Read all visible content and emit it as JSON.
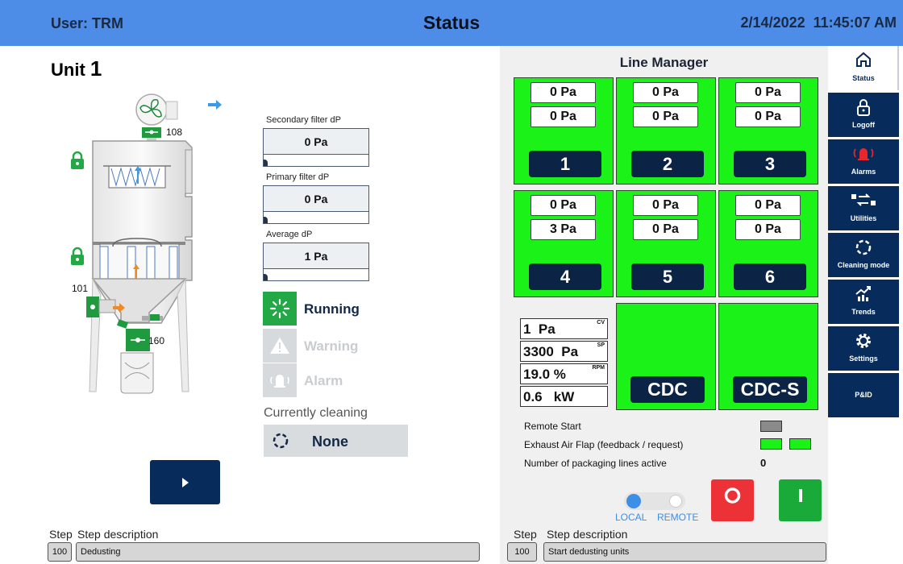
{
  "header": {
    "user": "User: TRM",
    "title": "Status",
    "datetime": "2/14/2022  11:45:07 AM"
  },
  "unit": {
    "title": "Unit",
    "number": "1",
    "labels": {
      "fan_id": "108",
      "left_valve_id": "101",
      "bottom_valve_id": "160"
    }
  },
  "filters": [
    {
      "label": "Secondary filter dP",
      "value": "0 Pa"
    },
    {
      "label": "Primary filter dP",
      "value": "0 Pa"
    },
    {
      "label": "Average dP",
      "value": "1 Pa"
    }
  ],
  "states": {
    "running": "Running",
    "warning": "Warning",
    "alarm": "Alarm"
  },
  "cleaning": {
    "label": "Currently cleaning",
    "value": "None"
  },
  "steps_left": {
    "step_header": "Step",
    "desc_header": "Step description",
    "step": "100",
    "description": "Dedusting"
  },
  "line_manager": {
    "title": "Line Manager",
    "cells": [
      {
        "top": "0 Pa",
        "bottom": "0 Pa",
        "id": "1"
      },
      {
        "top": "0 Pa",
        "bottom": "0 Pa",
        "id": "2"
      },
      {
        "top": "0 Pa",
        "bottom": "0 Pa",
        "id": "3"
      },
      {
        "top": "0 Pa",
        "bottom": "3 Pa",
        "id": "4"
      },
      {
        "top": "0 Pa",
        "bottom": "0 Pa",
        "id": "5"
      },
      {
        "top": "0 Pa",
        "bottom": "0 Pa",
        "id": "6"
      }
    ],
    "meters": [
      {
        "value": "1  Pa",
        "unit": "CV"
      },
      {
        "value": "3300  Pa",
        "unit": "SP"
      },
      {
        "value": "19.0 %",
        "unit": "RPM"
      },
      {
        "value": "0.6   kW",
        "unit": ""
      }
    ],
    "cdc": "CDC",
    "cdc_s": "CDC-S",
    "remote_start": "Remote Start",
    "exhaust_flap": "Exhaust Air Flap (feedback / request)",
    "packaging_lines": "Number of packaging lines active",
    "packaging_count": "0",
    "toggle_local": "LOCAL",
    "toggle_remote": "REMOTE",
    "colors": {
      "active_green": "#1bf217",
      "indicator_gray": "#8a8a8a"
    }
  },
  "steps_right": {
    "step_header": "Step",
    "desc_header": "Step description",
    "step": "100",
    "description": "Start dedusting units"
  },
  "nav": [
    {
      "label": "Status",
      "icon": "home-icon"
    },
    {
      "label": "Logoff",
      "icon": "lock-icon"
    },
    {
      "label": "Alarms",
      "icon": "alarm-bell-icon"
    },
    {
      "label": "Utilities",
      "icon": "utilities-icon"
    },
    {
      "label": "Cleaning mode",
      "icon": "cleaning-icon"
    },
    {
      "label": "Trends",
      "icon": "trends-icon"
    },
    {
      "label": "Settings",
      "icon": "gear-icon"
    },
    {
      "label": "P&ID",
      "icon": ""
    }
  ]
}
